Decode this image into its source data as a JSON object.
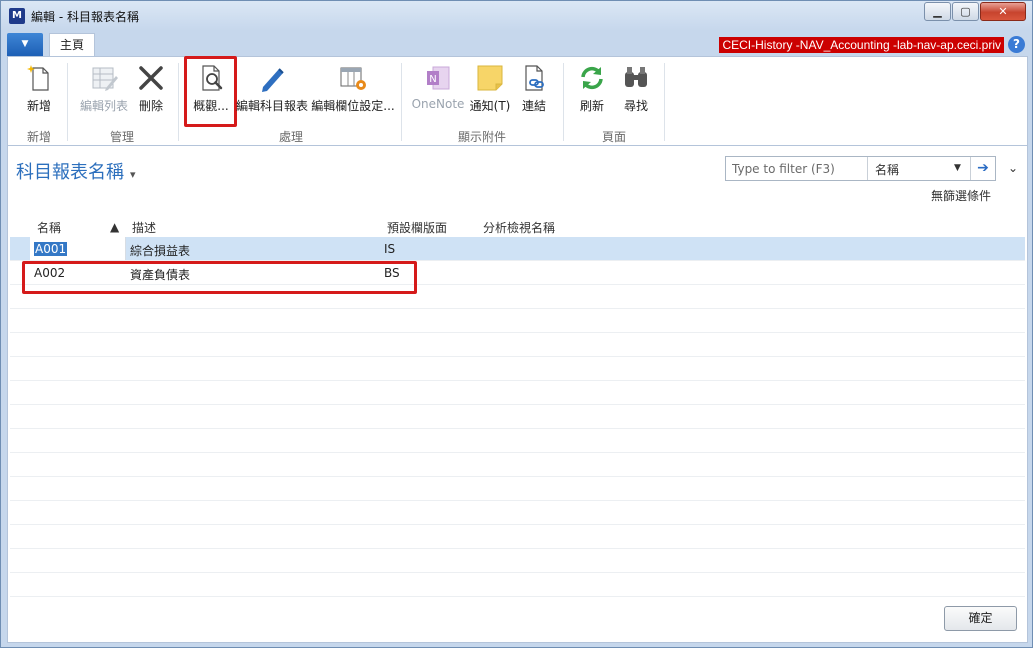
{
  "window": {
    "title": "編輯 - 科目報表名稱",
    "minimize": "▁",
    "maximize": "▢",
    "close": "✕"
  },
  "tabs": {
    "menu_arrow": "▼",
    "home": "主頁"
  },
  "server": {
    "label": "CECI-History -NAV_Accounting -lab-nav-ap.ceci.priv",
    "help": "?"
  },
  "ribbon": {
    "groups": [
      {
        "label": "新增"
      },
      {
        "label": "管理"
      },
      {
        "label": "處理"
      },
      {
        "label": "顯示附件"
      },
      {
        "label": "頁面"
      }
    ],
    "buttons": {
      "new": "新增",
      "edit_list": "編輯列表",
      "delete": "刪除",
      "overview": "概觀...",
      "edit_report": "編輯科目報表",
      "edit_columns": "編輯欄位設定...",
      "onenote": "OneNote",
      "notify": "通知(T)",
      "links": "連結",
      "refresh": "刷新",
      "find": "尋找"
    },
    "colors": {
      "highlight": "#d51a1a"
    }
  },
  "page": {
    "title": "科目報表名稱",
    "title_caret": "▾",
    "filter": {
      "placeholder": "Type to filter (F3)",
      "field": "名稱",
      "dropdown": "▼",
      "go": "➔"
    },
    "expand": "⌄",
    "no_filter": "無篩選條件"
  },
  "grid": {
    "headers": {
      "name": "名稱",
      "sort": "▲",
      "description": "描述",
      "column_layout": "預設欄版面",
      "analysis_view": "分析檢視名稱"
    },
    "rows": [
      {
        "name": "A001",
        "description": "綜合損益表",
        "column_layout": "IS",
        "analysis_view": ""
      },
      {
        "name": "A002",
        "description": "資產負債表",
        "column_layout": "BS",
        "analysis_view": ""
      }
    ]
  },
  "footer": {
    "ok": "確定"
  }
}
